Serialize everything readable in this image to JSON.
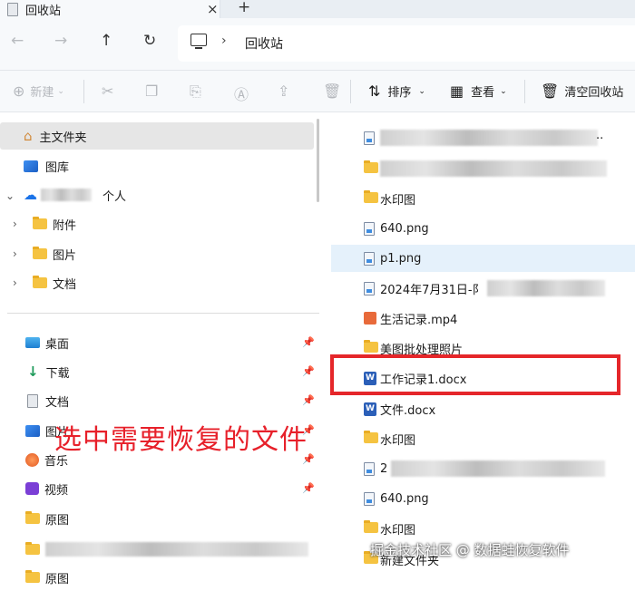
{
  "tab": {
    "title": "回收站",
    "close": "×",
    "new_tab": "+"
  },
  "nav_buttons": {
    "back": "←",
    "forward": "→",
    "up": "↑",
    "refresh": "↻"
  },
  "address": {
    "separator": "›",
    "location": "回收站"
  },
  "toolbar": {
    "new_label": "新建",
    "sort_label": "排序",
    "view_label": "查看",
    "empty_label": "清空回收站"
  },
  "sidebar": {
    "home": "主文件夹",
    "gallery": "图库",
    "onedrive_suffix": "个人",
    "onedrive_children": [
      "附件",
      "图片",
      "文档"
    ],
    "quick_access": [
      "桌面",
      "下载",
      "文档",
      "图片",
      "音乐",
      "视频",
      "原图",
      "",
      "原图"
    ]
  },
  "files": [
    {
      "name": "",
      "icon": "png-icon"
    },
    {
      "name": "",
      "icon": "folder-icon"
    },
    {
      "name": "水印图",
      "icon": "folder-icon"
    },
    {
      "name": "640.png",
      "icon": "png-icon"
    },
    {
      "name": "p1.png",
      "icon": "png-icon"
    },
    {
      "name": "2024年7月31日-阝",
      "icon": "png-icon"
    },
    {
      "name": "生活记录.mp4",
      "icon": "mp4-icon"
    },
    {
      "name": "美图批处理照片",
      "icon": "folder-icon"
    },
    {
      "name": "工作记录1.docx",
      "icon": "word-icon"
    },
    {
      "name": "文件.docx",
      "icon": "word-icon"
    },
    {
      "name": "水印图",
      "icon": "folder-icon"
    },
    {
      "name": "2",
      "icon": "png-icon"
    },
    {
      "name": "640.png",
      "icon": "png-icon"
    },
    {
      "name": "水印图",
      "icon": "folder-icon"
    },
    {
      "name": "新建文件夹",
      "icon": "folder-icon"
    }
  ],
  "annotation": "选中需要恢复的文件",
  "watermark": "掘金技术社区 @ 数据蛙恢复软件",
  "colors": {
    "highlight": "#e5262a",
    "hover_row": "#e5f1fb",
    "selected_nav": "#e6e6e6"
  }
}
